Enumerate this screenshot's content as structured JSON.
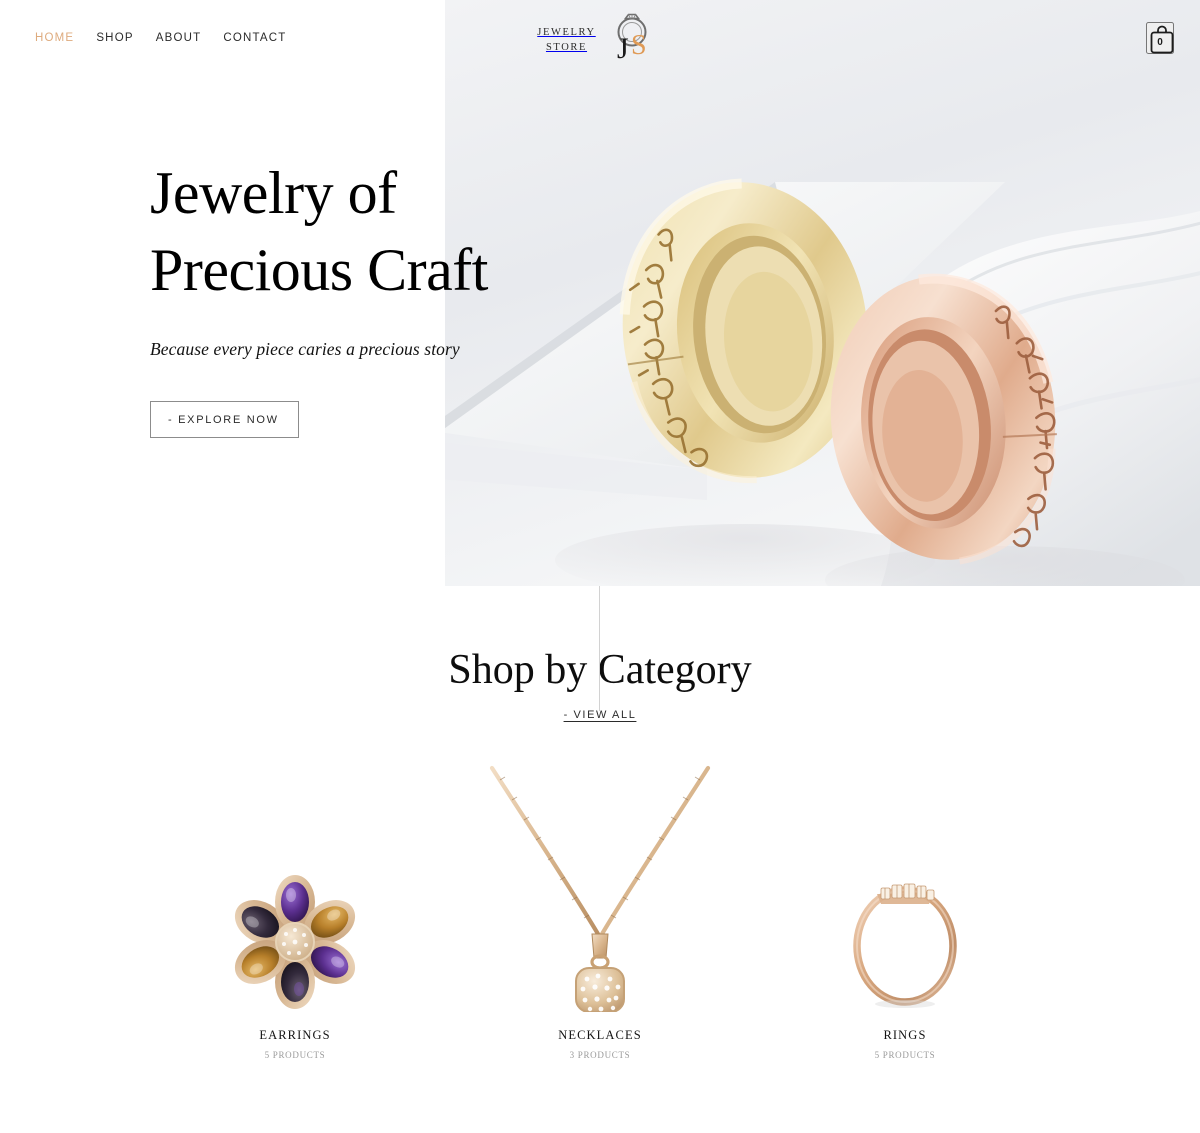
{
  "nav": {
    "items": [
      {
        "label": "HOME",
        "active": true
      },
      {
        "label": "SHOP",
        "active": false
      },
      {
        "label": "ABOUT",
        "active": false
      },
      {
        "label": "CONTACT",
        "active": false
      }
    ]
  },
  "logo": {
    "line1": "JEWELRY",
    "line2": "STORE",
    "monogram_j": "J",
    "monogram_s": "S",
    "icon": "ring-icon"
  },
  "cart": {
    "icon": "shopping-bag-icon",
    "count": "0"
  },
  "hero": {
    "title_line1": "Jewelry of",
    "title_line2": "Precious Craft",
    "subtitle": "Because every piece caries a precious story",
    "cta_label": "- EXPLORE NOW",
    "image_alt": "two-engraved-wedding-bands"
  },
  "categories_section": {
    "heading": "Shop by Category",
    "view_all_label": "- VIEW ALL",
    "items": [
      {
        "name": "EARRINGS",
        "count": "5 PRODUCTS",
        "image_alt": "flower-gemstone-earring"
      },
      {
        "name": "NECKLACES",
        "count": "3 PRODUCTS",
        "image_alt": "gold-chain-pave-pendant-necklace"
      },
      {
        "name": "RINGS",
        "count": "5 PRODUCTS",
        "image_alt": "rose-gold-diamond-ring"
      }
    ]
  },
  "colors": {
    "accent": "#deab7e",
    "text": "#1c1c1c",
    "muted": "#9a9a9a",
    "divider": "#d2d2d2",
    "gold": "#e3c98f",
    "rose_gold": "#e0b194"
  }
}
